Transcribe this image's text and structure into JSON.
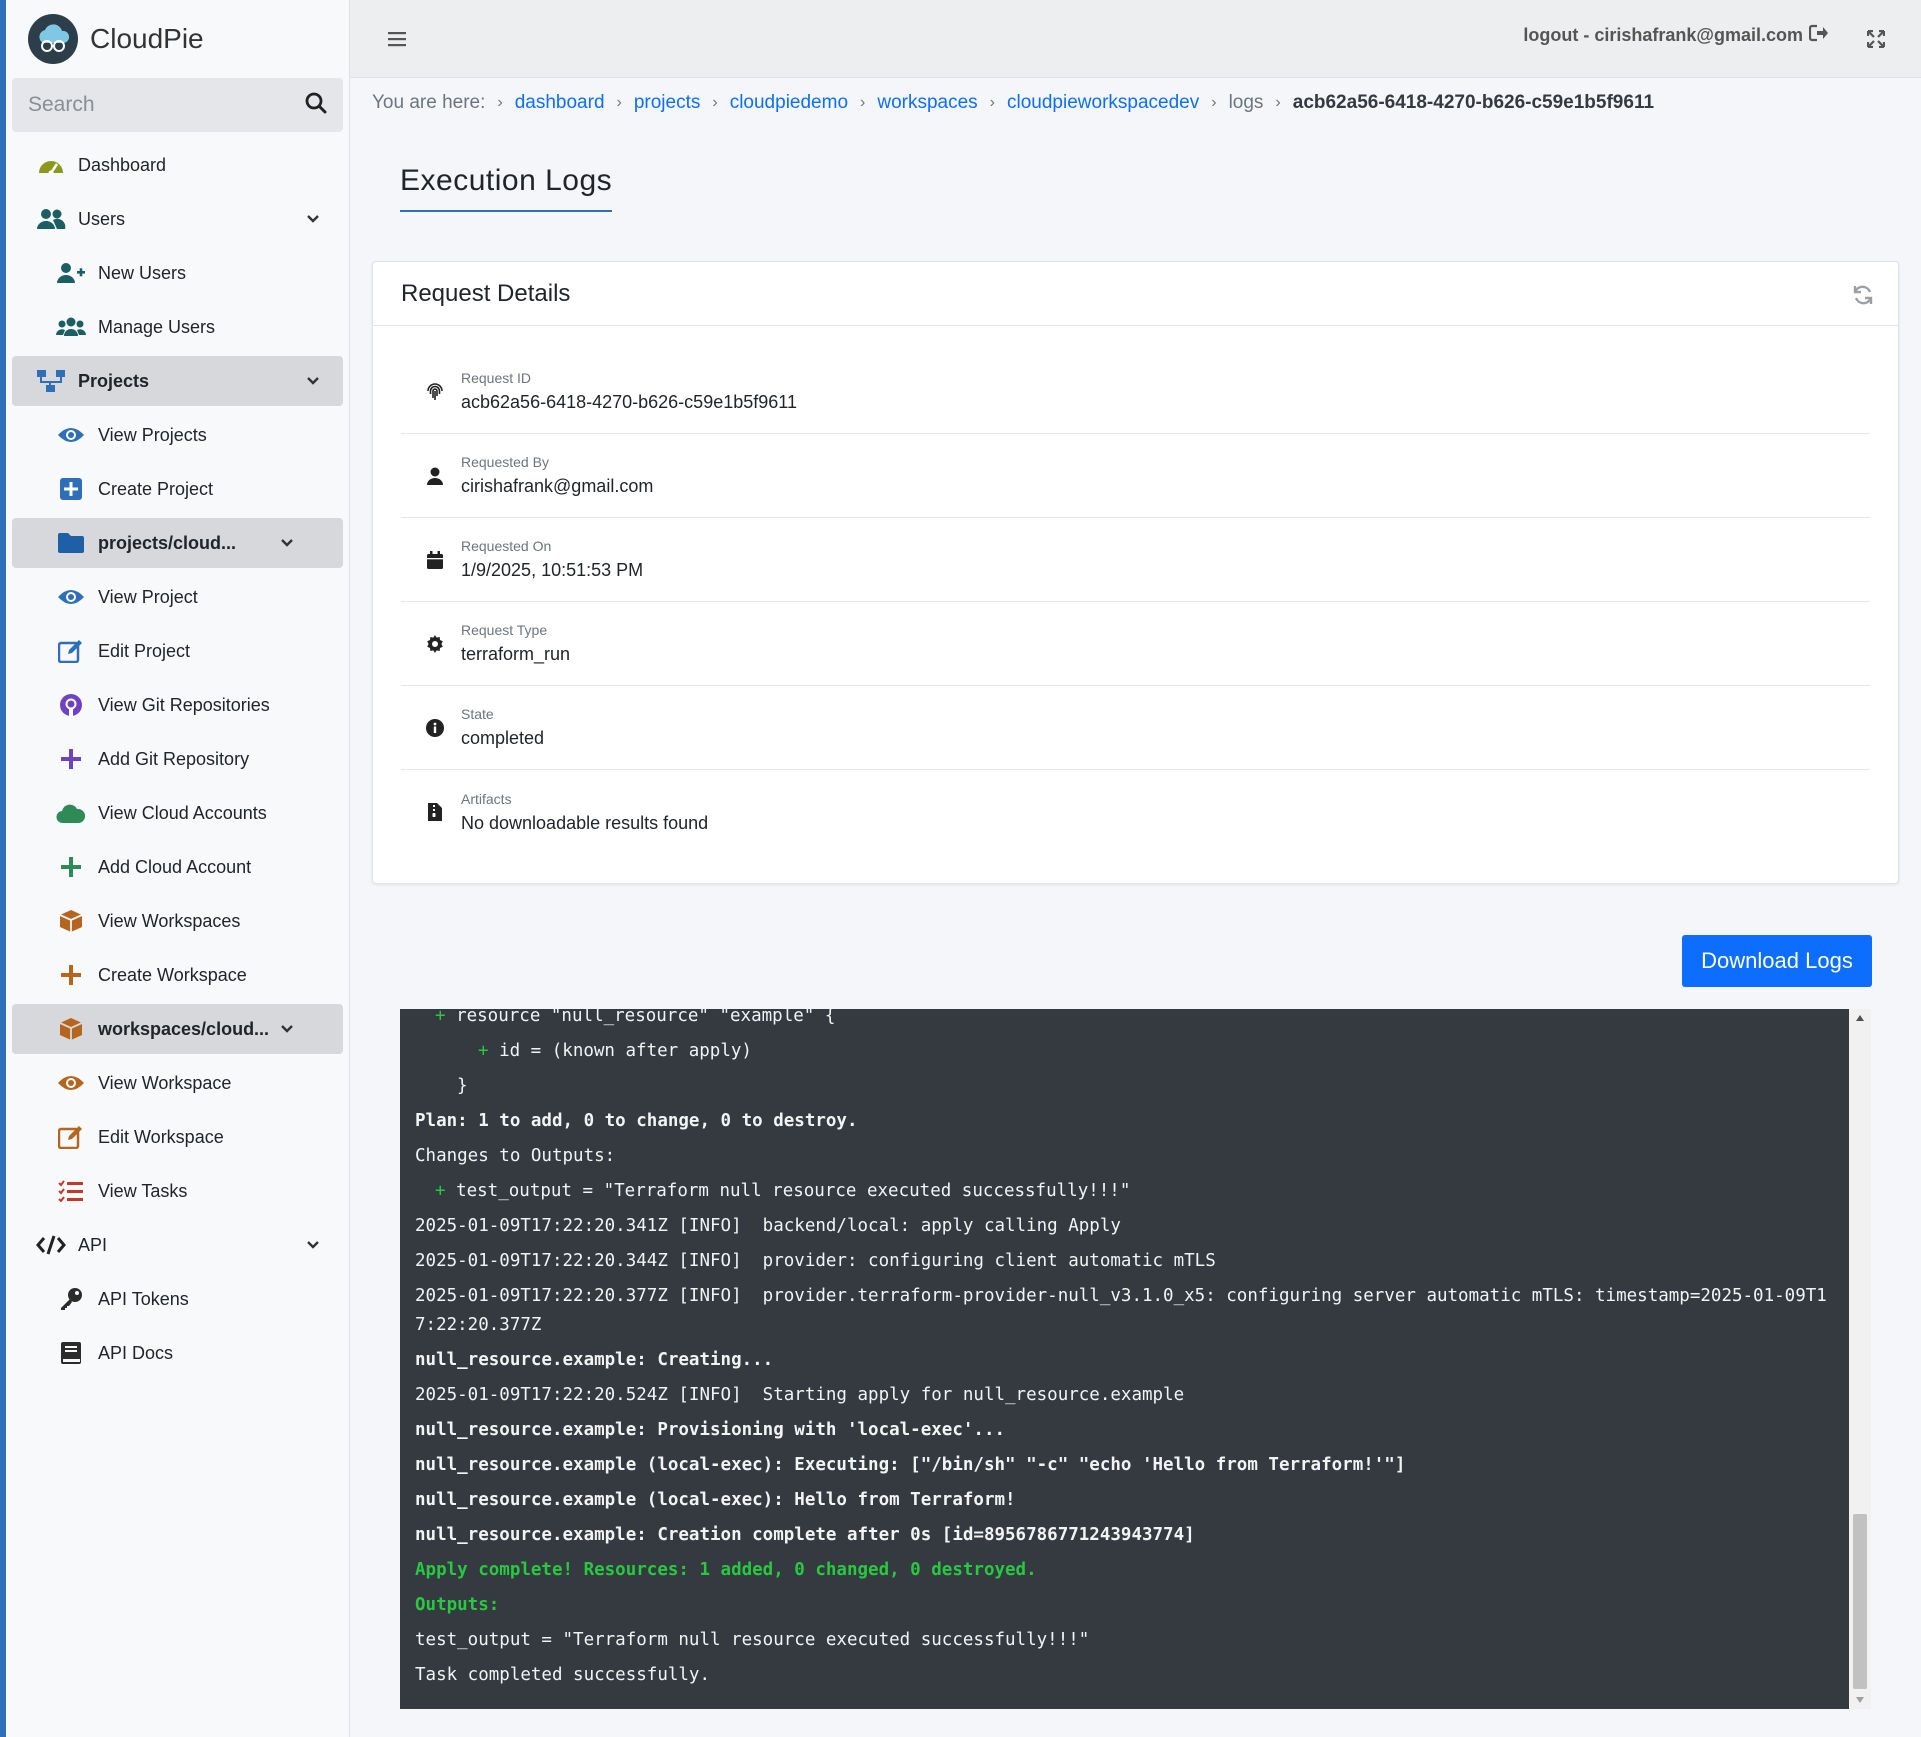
{
  "brand": {
    "name": "CloudPie"
  },
  "search": {
    "placeholder": "Search"
  },
  "sidebar": {
    "dashboard": "Dashboard",
    "users": "Users",
    "new_users": "New Users",
    "manage_users": "Manage Users",
    "projects": "Projects",
    "view_projects": "View Projects",
    "create_project": "Create Project",
    "current_project": "projects/cloud...",
    "view_project": "View Project",
    "edit_project": "Edit Project",
    "view_git_repos": "View Git Repositories",
    "add_git_repo": "Add Git Repository",
    "view_cloud_accounts": "View Cloud Accounts",
    "add_cloud_account": "Add Cloud Account",
    "view_workspaces": "View Workspaces",
    "create_workspace": "Create Workspace",
    "current_workspace": "workspaces/cloud...",
    "view_workspace": "View Workspace",
    "edit_workspace": "Edit Workspace",
    "view_tasks": "View Tasks",
    "api": "API",
    "api_tokens": "API Tokens",
    "api_docs": "API Docs"
  },
  "topbar": {
    "logout": "logout - cirishafrank@gmail.com"
  },
  "breadcrumb": {
    "prefix": "You are here:",
    "dashboard": "dashboard",
    "projects": "projects",
    "project": "cloudpiedemo",
    "workspaces": "workspaces",
    "workspace": "cloudpieworkspacedev",
    "logs": "logs",
    "current": "acb62a56-6418-4270-b626-c59e1b5f9611"
  },
  "page": {
    "title": "Execution Logs"
  },
  "card": {
    "title": "Request Details",
    "details": [
      {
        "label": "Request ID",
        "value": "acb62a56-6418-4270-b626-c59e1b5f9611"
      },
      {
        "label": "Requested By",
        "value": "cirishafrank@gmail.com"
      },
      {
        "label": "Requested On",
        "value": "1/9/2025, 10:51:53 PM"
      },
      {
        "label": "Request Type",
        "value": "terraform_run"
      },
      {
        "label": "State",
        "value": "completed"
      },
      {
        "label": "Artifacts",
        "value": "No downloadable results found"
      }
    ]
  },
  "download_button": "Download Logs",
  "logs": [
    "resource \"null_resource\" \"example\" {",
    "id = (known after apply)",
    "}",
    "Plan: 1 to add, 0 to change, 0 to destroy.",
    "Changes to Outputs:",
    "test_output = \"Terraform null resource executed successfully!!!\"",
    "2025-01-09T17:22:20.341Z [INFO]  backend/local: apply calling Apply",
    "2025-01-09T17:22:20.344Z [INFO]  provider: configuring client automatic mTLS",
    "2025-01-09T17:22:20.377Z [INFO]  provider.terraform-provider-null_v3.1.0_x5: configuring server automatic mTLS: timestamp=2025-01-09T17:22:20.377Z",
    "null_resource.example: Creating...",
    "2025-01-09T17:22:20.524Z [INFO]  Starting apply for null_resource.example",
    "null_resource.example: Provisioning with 'local-exec'...",
    "null_resource.example (local-exec): Executing: [\"/bin/sh\" \"-c\" \"echo 'Hello from Terraform!'\"]",
    "null_resource.example (local-exec): Hello from Terraform!",
    "null_resource.example: Creation complete after 0s [id=8956786771243943774]",
    "Apply complete! Resources: 1 added, 0 changed, 0 destroyed.",
    "Outputs:",
    "test_output = \"Terraform null resource executed successfully!!!\"",
    "Task completed successfully."
  ],
  "colors": {
    "accent": "#2f6fb8",
    "link": "#0d6efd",
    "button": "#0d6efd",
    "console_bg": "#343a40",
    "console_green": "#28c840"
  }
}
